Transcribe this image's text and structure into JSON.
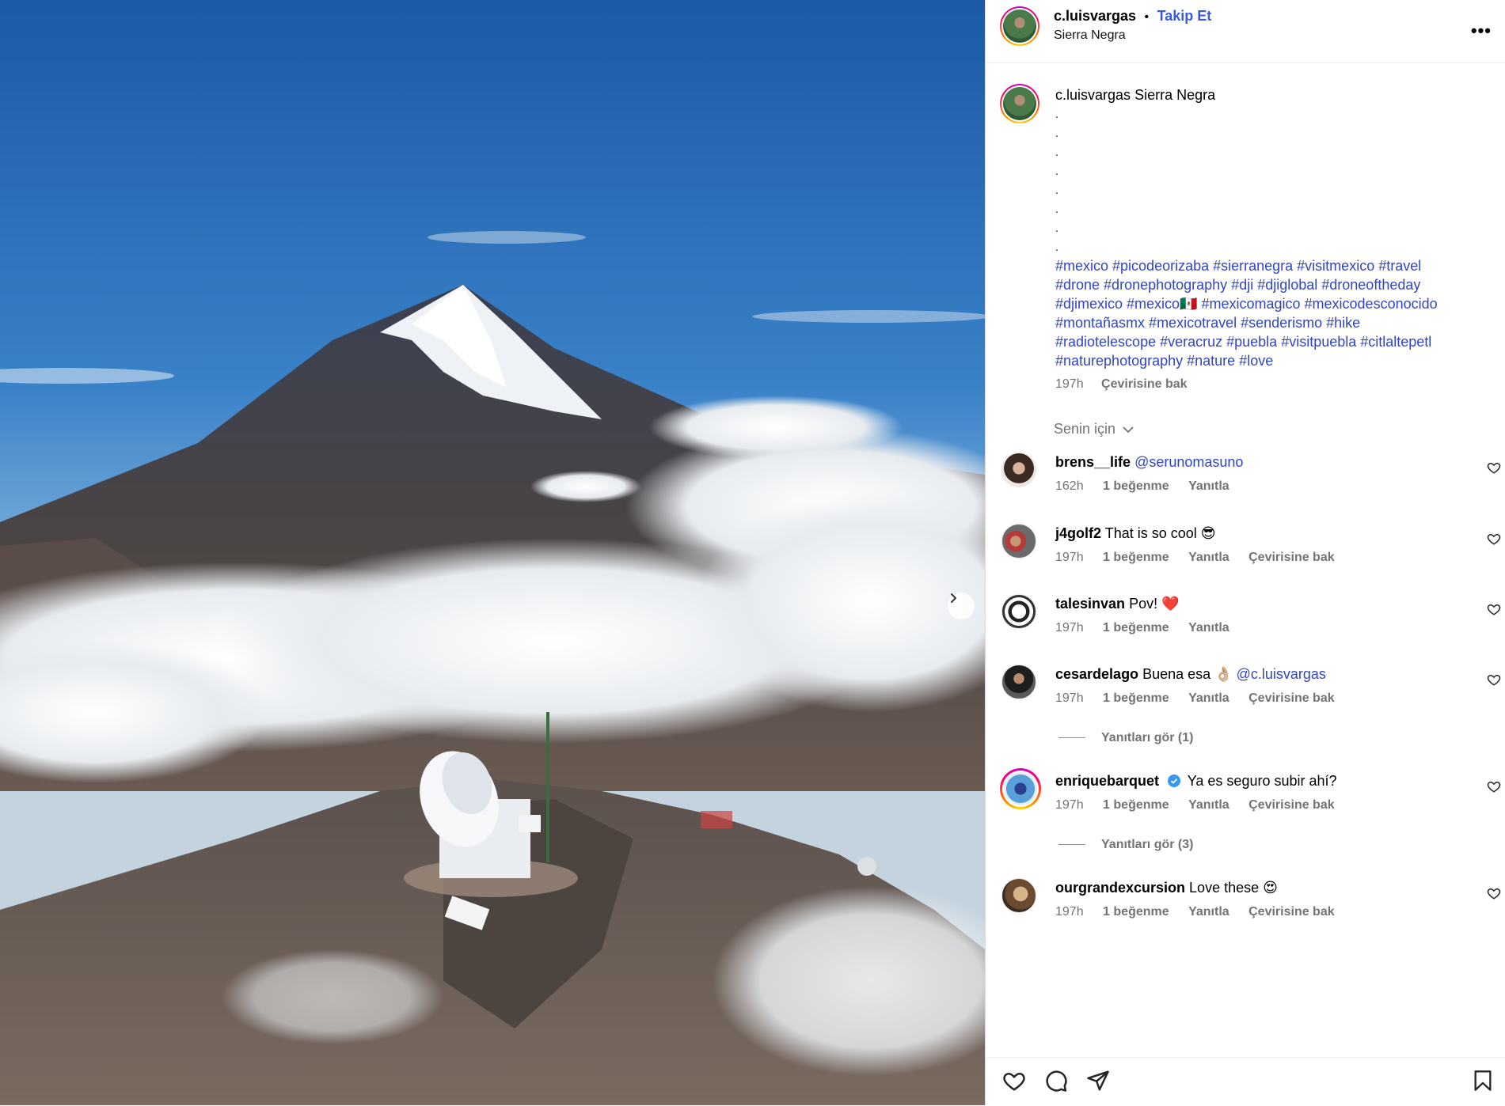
{
  "post": {
    "username": "c.luisvargas",
    "separator": "•",
    "follow_label": "Takip Et",
    "location": "Sierra Negra",
    "more_label": "•••"
  },
  "caption": {
    "username": "c.luisvargas",
    "text": "Sierra Negra",
    "dots": [
      ".",
      ".",
      ".",
      ".",
      ".",
      ".",
      ".",
      "."
    ],
    "hashtag_lines": [
      "#mexico #picodeorizaba #sierranegra #visitmexico #travel",
      "#drone #dronephotography #dji #djiglobal #droneoftheday",
      "#djimexico #mexico🇲🇽 #mexicomagico #mexicodesconocido",
      "#montañasmx #mexicotravel #senderismo #hike",
      "#radiotelescope #veracruz #puebla #visitpuebla #citlaltepetl",
      "#naturephotography #nature #love"
    ],
    "time": "197h",
    "translate_label": "Çevirisine bak"
  },
  "comments_filter": "Senin için",
  "comments": [
    {
      "username": "brens__life",
      "text": "",
      "mention": "@serunomasuno",
      "time": "162h",
      "likes": "1 beğenme",
      "reply": "Yanıtla",
      "translate": ""
    },
    {
      "username": "j4golf2",
      "text": "That is so cool 😎",
      "mention": "",
      "time": "197h",
      "likes": "1 beğenme",
      "reply": "Yanıtla",
      "translate": "Çevirisine bak"
    },
    {
      "username": "talesinvan",
      "text": "Pov! ❤️",
      "mention": "",
      "time": "197h",
      "likes": "1 beğenme",
      "reply": "Yanıtla",
      "translate": ""
    },
    {
      "username": "cesardelago",
      "text": "Buena esa 👌🏼",
      "mention": "@c.luisvargas",
      "time": "197h",
      "likes": "1 beğenme",
      "reply": "Yanıtla",
      "translate": "Çevirisine bak"
    },
    {
      "username": "enriquebarquet",
      "text": "Ya es seguro subir ahí?",
      "mention": "",
      "time": "197h",
      "likes": "1 beğenme",
      "reply": "Yanıtla",
      "translate": "Çevirisine bak"
    },
    {
      "username": "ourgrandexcursion",
      "text": "Love these 😍",
      "mention": "",
      "time": "197h",
      "likes": "1 beğenme",
      "reply": "Yanıtla",
      "translate": "Çevirisine bak"
    }
  ],
  "view_replies": [
    "Yanıtları gör (1)",
    "Yanıtları gör (3)"
  ],
  "icons": [
    "heart-icon",
    "comment-icon",
    "share-icon",
    "bookmark-icon",
    "chevron-right-icon",
    "chevron-down-icon",
    "verified-icon"
  ],
  "colors": {
    "link": "#2f46c2",
    "follow": "#3a5bd9",
    "muted": "#737373"
  }
}
